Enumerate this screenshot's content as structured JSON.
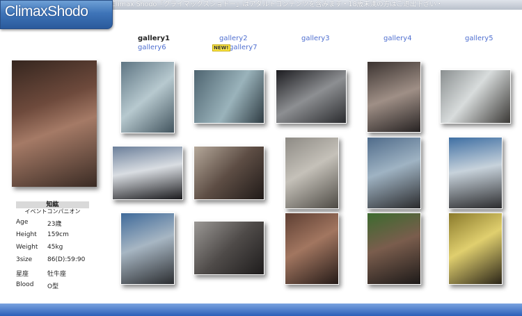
{
  "header": {
    "logo_text": "ClimaxShodo",
    "notice": "Climax Shodo「クライマックスショドー」はアダルトコンテンツを含みます・18歳未満の方はご退出下さい・"
  },
  "nav": {
    "galleries": [
      "gallery1",
      "gallery2",
      "gallery3",
      "gallery4",
      "gallery5",
      "gallery6",
      "gallery7"
    ],
    "current": "gallery1",
    "new_badge": "NEW!"
  },
  "profile": {
    "name": "知紘",
    "role": "イベントコンパニオン",
    "fields": [
      {
        "label": "Age",
        "value": "23歳"
      },
      {
        "label": "Height",
        "value": "159cm"
      },
      {
        "label": "Weight",
        "value": "45kg"
      },
      {
        "label": "3size",
        "value": "86(D):59:90"
      },
      {
        "label": "星座",
        "value": "牡牛座"
      },
      {
        "label": "Blood",
        "value": "O型"
      }
    ]
  },
  "colors": {
    "link": "#4f6fd0",
    "accent": "#3e74b8",
    "badge": "#ffe94a"
  }
}
